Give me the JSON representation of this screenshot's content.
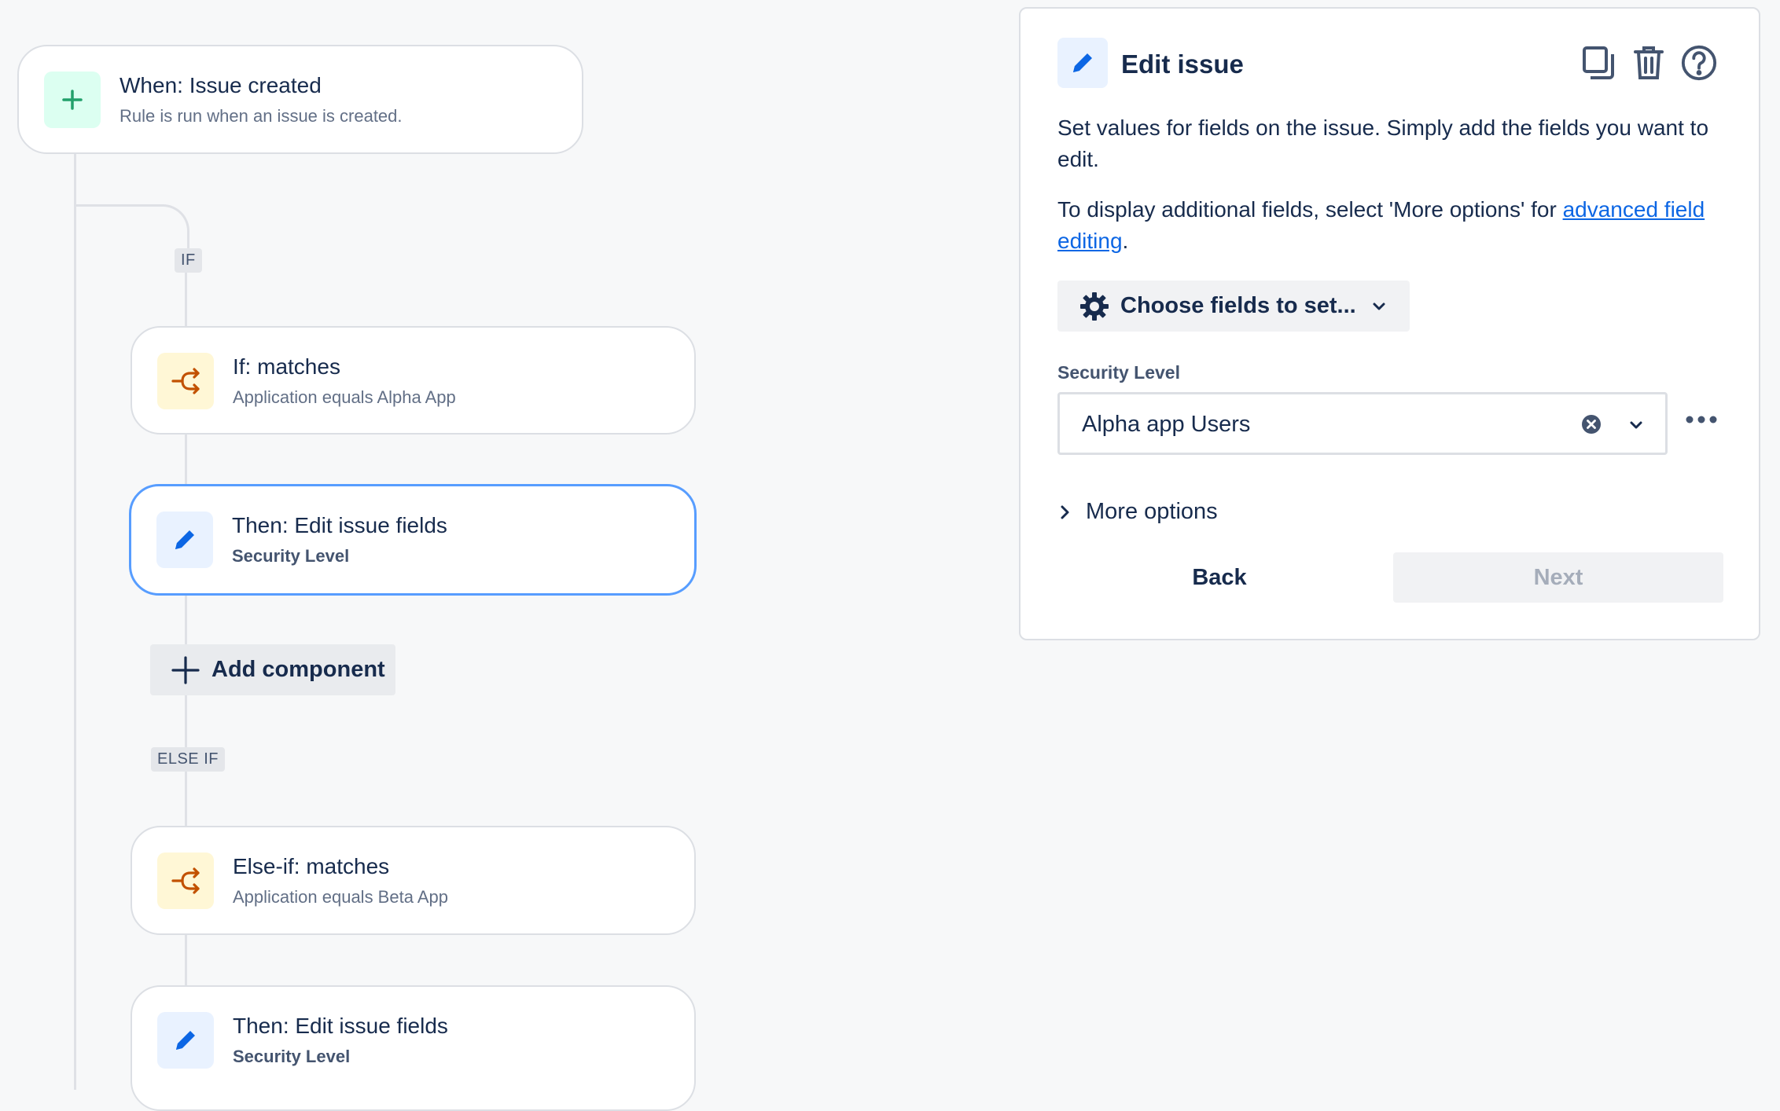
{
  "flow": {
    "trigger": {
      "title": "When: Issue created",
      "subtitle": "Rule is run when an issue is created."
    },
    "if_label": "IF",
    "if_condition": {
      "title": "If: matches",
      "subtitle": "Application equals Alpha App"
    },
    "then_action_1": {
      "title": "Then: Edit issue fields",
      "subtitle": "Security Level"
    },
    "add_component_label": "Add component",
    "else_if_label": "ELSE IF",
    "else_if_condition": {
      "title": "Else-if: matches",
      "subtitle": "Application equals Beta App"
    },
    "then_action_2": {
      "title": "Then: Edit issue fields",
      "subtitle": "Security Level"
    }
  },
  "panel": {
    "title": "Edit issue",
    "description": "Set values for fields on the issue. Simply add the fields you want to edit.",
    "additional_prefix": "To display additional fields, select 'More options' for ",
    "additional_link": "advanced field editing",
    "additional_suffix": ".",
    "choose_fields_label": "Choose fields to set...",
    "field_label": "Security Level",
    "field_value": "Alpha app Users",
    "more_options_label": "More options",
    "back_label": "Back",
    "next_label": "Next",
    "next_enabled": false
  },
  "icons": {
    "trigger": "plus-icon",
    "condition": "branch-icon",
    "action": "pencil-icon",
    "panel_actions": [
      "copy-icon",
      "trash-icon",
      "help-icon"
    ]
  },
  "colors": {
    "accent": "#0c66e4",
    "selected_border": "#579dff",
    "trigger_icon": "#22a06b",
    "condition_icon": "#c25100",
    "action_icon": "#0c66e4"
  }
}
